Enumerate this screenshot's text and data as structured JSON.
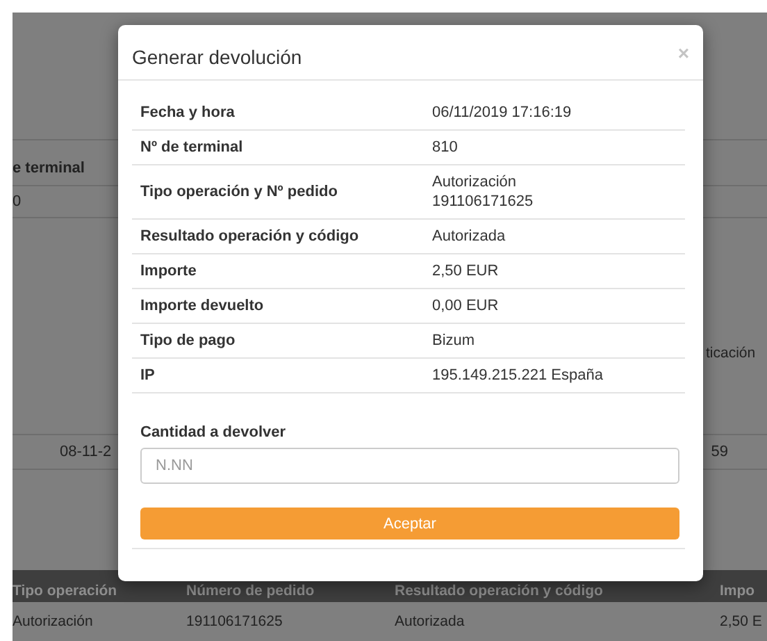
{
  "background_page": {
    "header_fragment": "e terminal",
    "cell_fragment": "0",
    "side_fragment": "ticación",
    "row_date_fragment": "08-11-2",
    "row_time_fragment": "59",
    "table": {
      "columns": [
        "Tipo operación",
        "Número de pedido",
        "Resultado operación y código",
        "Impo"
      ],
      "rows": [
        [
          "Autorización",
          "191106171625",
          "Autorizada",
          "2,50 E"
        ]
      ]
    }
  },
  "modal": {
    "title": "Generar devolución",
    "close": "×",
    "details": [
      {
        "label": "Fecha y hora",
        "values": [
          "06/11/2019 17:16:19"
        ]
      },
      {
        "label": "Nº de terminal",
        "values": [
          "810"
        ]
      },
      {
        "label": "Tipo operación y Nº pedido",
        "values": [
          "Autorización",
          "191106171625"
        ]
      },
      {
        "label": "Resultado operación y código",
        "values": [
          "Autorizada"
        ]
      },
      {
        "label": "Importe",
        "values": [
          "2,50 EUR"
        ]
      },
      {
        "label": "Importe devuelto",
        "values": [
          "0,00 EUR"
        ]
      },
      {
        "label": "Tipo de pago",
        "values": [
          "Bizum"
        ]
      },
      {
        "label": "IP",
        "values": [
          "195.149.215.221 España"
        ]
      }
    ],
    "amount_field": {
      "label": "Cantidad a devolver",
      "placeholder": "N.NN"
    },
    "submit": "Aceptar"
  }
}
